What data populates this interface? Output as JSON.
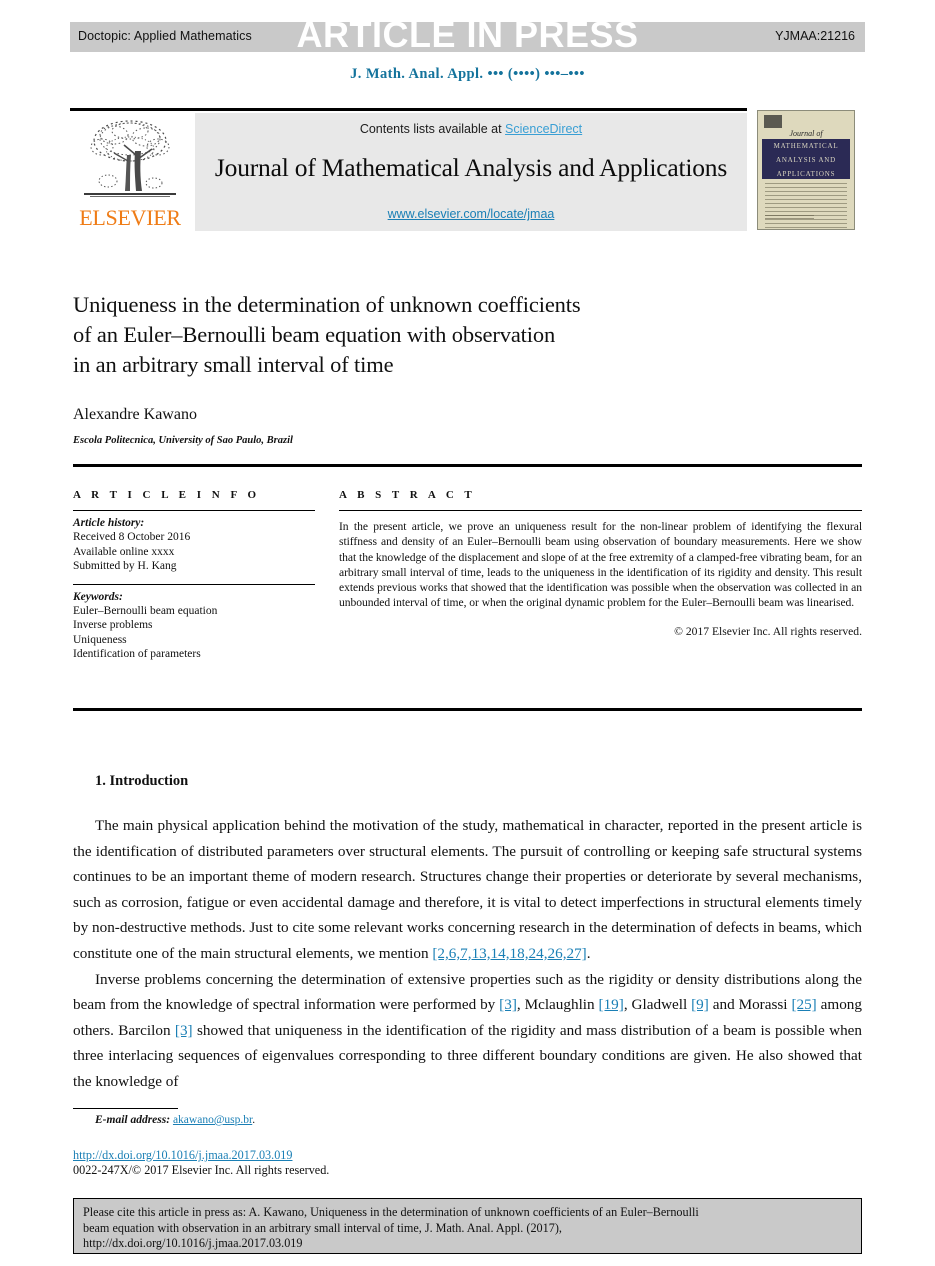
{
  "header": {
    "doctopic": "Doctopic: Applied Mathematics",
    "article_in_press": "ARTICLE IN PRESS",
    "article_number": "YJMAA:21216",
    "running_head": "J. Math. Anal. Appl. ••• (••••) •••–•••"
  },
  "masthead": {
    "contents_prefix": "Contents lists available at ",
    "sciencedirect": "ScienceDirect",
    "journal_title": "Journal of Mathematical Analysis and Applications",
    "journal_url": "www.elsevier.com/locate/jmaa",
    "publisher_wordmark": "ELSEVIER"
  },
  "cover": {
    "journal_of": "Journal of",
    "band_line1": "MATHEMATICAL",
    "band_line2": "ANALYSIS AND",
    "band_line3": "APPLICATIONS"
  },
  "article": {
    "title_line1": "Uniqueness in the determination of unknown coefficients",
    "title_line2": "of an Euler–Bernoulli beam equation with observation",
    "title_line3": "in an arbitrary small interval of time",
    "author": "Alexandre Kawano",
    "affiliation": "Escola Politecnica, University of Sao Paulo, Brazil"
  },
  "info": {
    "heading": "A R T I C L E   I N F O",
    "history_label": "Article history:",
    "history": [
      "Received 8 October 2016",
      "Available online xxxx",
      "Submitted by H. Kang"
    ],
    "keywords_label": "Keywords:",
    "keywords": [
      "Euler–Bernoulli beam equation",
      "Inverse problems",
      "Uniqueness",
      "Identification of parameters"
    ]
  },
  "abstract": {
    "heading": "A B S T R A C T",
    "text": "In the present article, we prove an uniqueness result for the non-linear problem of identifying the flexural stiffness and density of an Euler–Bernoulli beam using observation of boundary measurements. Here we show that the knowledge of the displacement and slope of at the free extremity of a clamped-free vibrating beam, for an arbitrary small interval of time, leads to the uniqueness in the identification of its rigidity and density. This result extends previous works that showed that the identification was possible when the observation was collected in an unbounded interval of time, or when the original dynamic problem for the Euler–Bernoulli beam was linearised.",
    "copyright": "© 2017 Elsevier Inc. All rights reserved."
  },
  "body": {
    "section_number_title": "1. Introduction",
    "paragraph1_a": "The main physical application behind the motivation of the study, mathematical in character, reported in the present article is the identification of distributed parameters over structural elements. The pursuit of controlling or keeping safe structural systems continues to be an important theme of modern research. Structures change their properties or deteriorate by several mechanisms, such as corrosion, fatigue or even accidental damage and therefore, it is vital to detect imperfections in structural elements timely by non-destructive methods. Just to cite some relevant works concerning research in the determination of defects in beams, which constitute one of the main structural elements, we mention ",
    "paragraph1_ref": "[2,6,7,13,14,18,24,26,27]",
    "paragraph1_b": ".",
    "paragraph2_a": "Inverse problems concerning the determination of extensive properties such as the rigidity or density distributions along the beam from the knowledge of spectral information were performed by ",
    "paragraph2_ref1": "[3]",
    "paragraph2_b": ", Mclaughlin ",
    "paragraph2_ref2": "[19]",
    "paragraph2_c": ", Gladwell ",
    "paragraph2_ref3": "[9]",
    "paragraph2_d": " and Morassi ",
    "paragraph2_ref4": "[25]",
    "paragraph2_e": " among others. Barcilon ",
    "paragraph2_ref5": "[3]",
    "paragraph2_f": " showed that uniqueness in the identification of the rigidity and mass distribution of a beam is possible when three interlacing sequences of eigenvalues corresponding to three different boundary conditions are given. He also showed that the knowledge of"
  },
  "footnote": {
    "email_label": "E-mail address:",
    "email": "akawano@usp.br",
    "email_period": ".",
    "doi_url": "http://dx.doi.org/10.1016/j.jmaa.2017.03.019",
    "issn_line": "0022-247X/© 2017 Elsevier Inc. All rights reserved."
  },
  "cite_box": {
    "line1": "Please cite this article in press as: A. Kawano, Uniqueness in the determination of unknown coefficients of an Euler–Bernoulli",
    "line2": "beam equation with observation in an arbitrary small interval of time, J. Math. Anal. Appl. (2017),",
    "line3": "http://dx.doi.org/10.1016/j.jmaa.2017.03.019"
  },
  "colors": {
    "link_blue": "#1a7fb5",
    "sciencedirect_blue": "#3a9fd4",
    "runhead_teal": "#14739c",
    "elsevier_orange": "#ef7c16",
    "gray_bar": "#c9c9c9",
    "panel_gray": "#e8e8e8",
    "cover_navy": "#2b2a55",
    "cover_cream": "#ded9bd"
  }
}
